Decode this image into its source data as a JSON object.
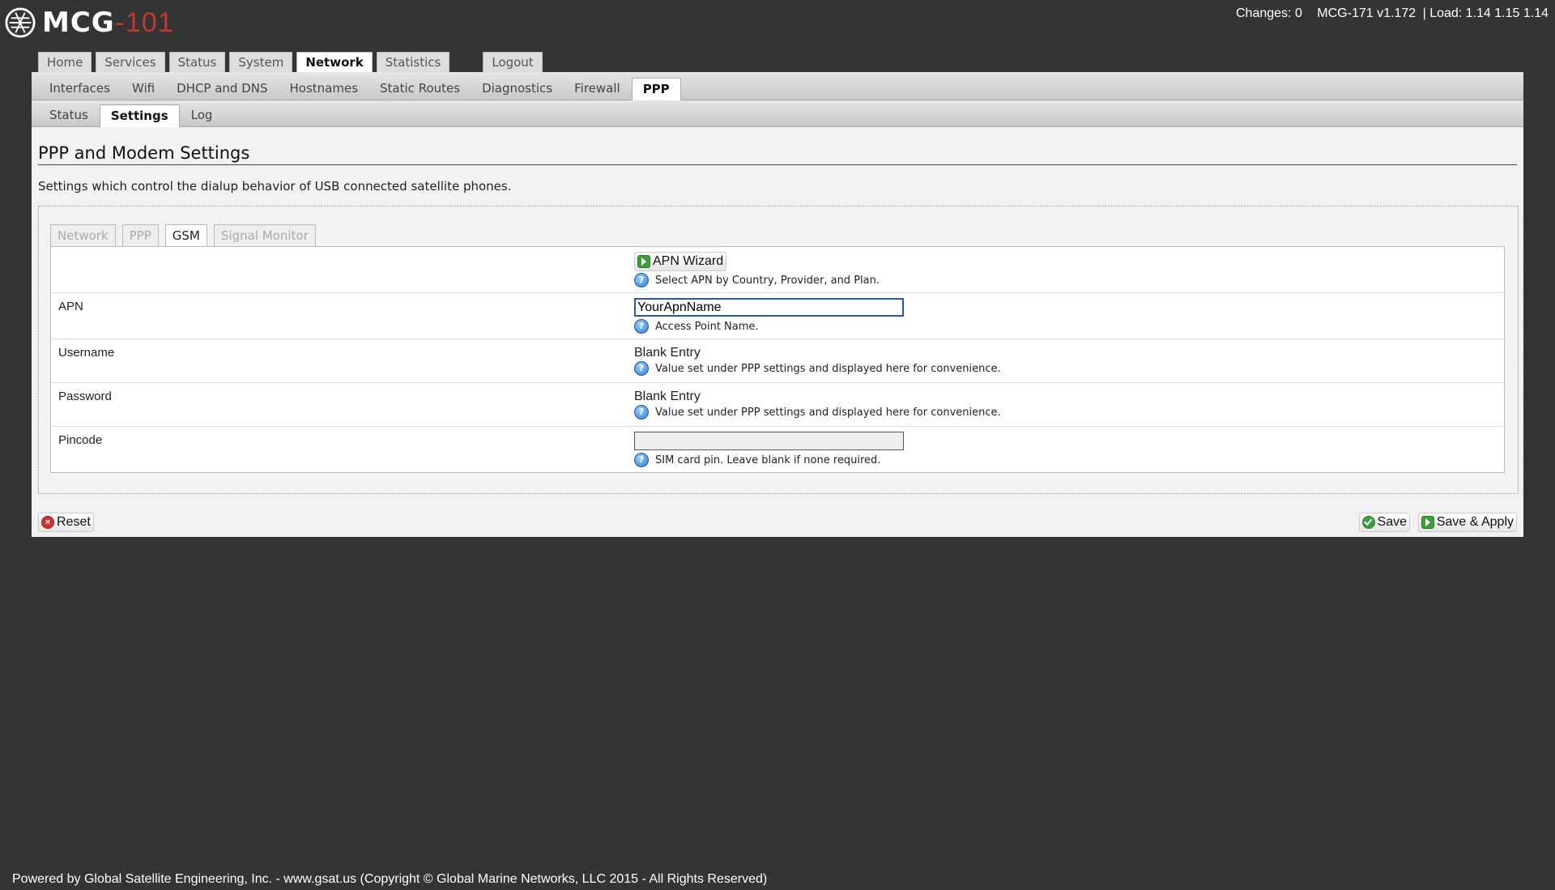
{
  "header": {
    "logo_text": "MCG",
    "logo_dash": "-",
    "logo_num": "101",
    "changes": "Changes: 0",
    "version": "MCG-171 v1.172",
    "load": "| Load: 1.14 1.15 1.14"
  },
  "main_tabs": [
    "Home",
    "Services",
    "Status",
    "System",
    "Network",
    "Statistics"
  ],
  "logout_label": "Logout",
  "sub_tabs": [
    "Interfaces",
    "Wifi",
    "DHCP and DNS",
    "Hostnames",
    "Static Routes",
    "Diagnostics",
    "Firewall",
    "PPP"
  ],
  "sub_sub_tabs": [
    "Status",
    "Settings",
    "Log"
  ],
  "page": {
    "title": "PPP and Modem Settings",
    "description": "Settings which control the dialup behavior of USB connected satellite phones."
  },
  "inner_tabs": [
    "Network",
    "PPP",
    "GSM",
    "Signal Monitor"
  ],
  "form": {
    "wizard_label": "APN Wizard",
    "wizard_help": "Select APN by Country, Provider, and Plan.",
    "apn_label": "APN",
    "apn_value": "YourApnName",
    "apn_help": "Access Point Name.",
    "username_label": "Username",
    "username_value": "Blank Entry",
    "username_help": "Value set under PPP settings and displayed here for convenience.",
    "password_label": "Password",
    "password_value": "Blank Entry",
    "password_help": "Value set under PPP settings and displayed here for convenience.",
    "pincode_label": "Pincode",
    "pincode_value": "",
    "pincode_help": "SIM card pin. Leave blank if none required."
  },
  "buttons": {
    "reset": "Reset",
    "save": "Save",
    "save_apply": "Save & Apply"
  },
  "footer": "Powered by Global Satellite Engineering, Inc. - www.gsat.us (Copyright © Global Marine Networks, LLC 2015 - All Rights Reserved)",
  "help_glyph": "?"
}
